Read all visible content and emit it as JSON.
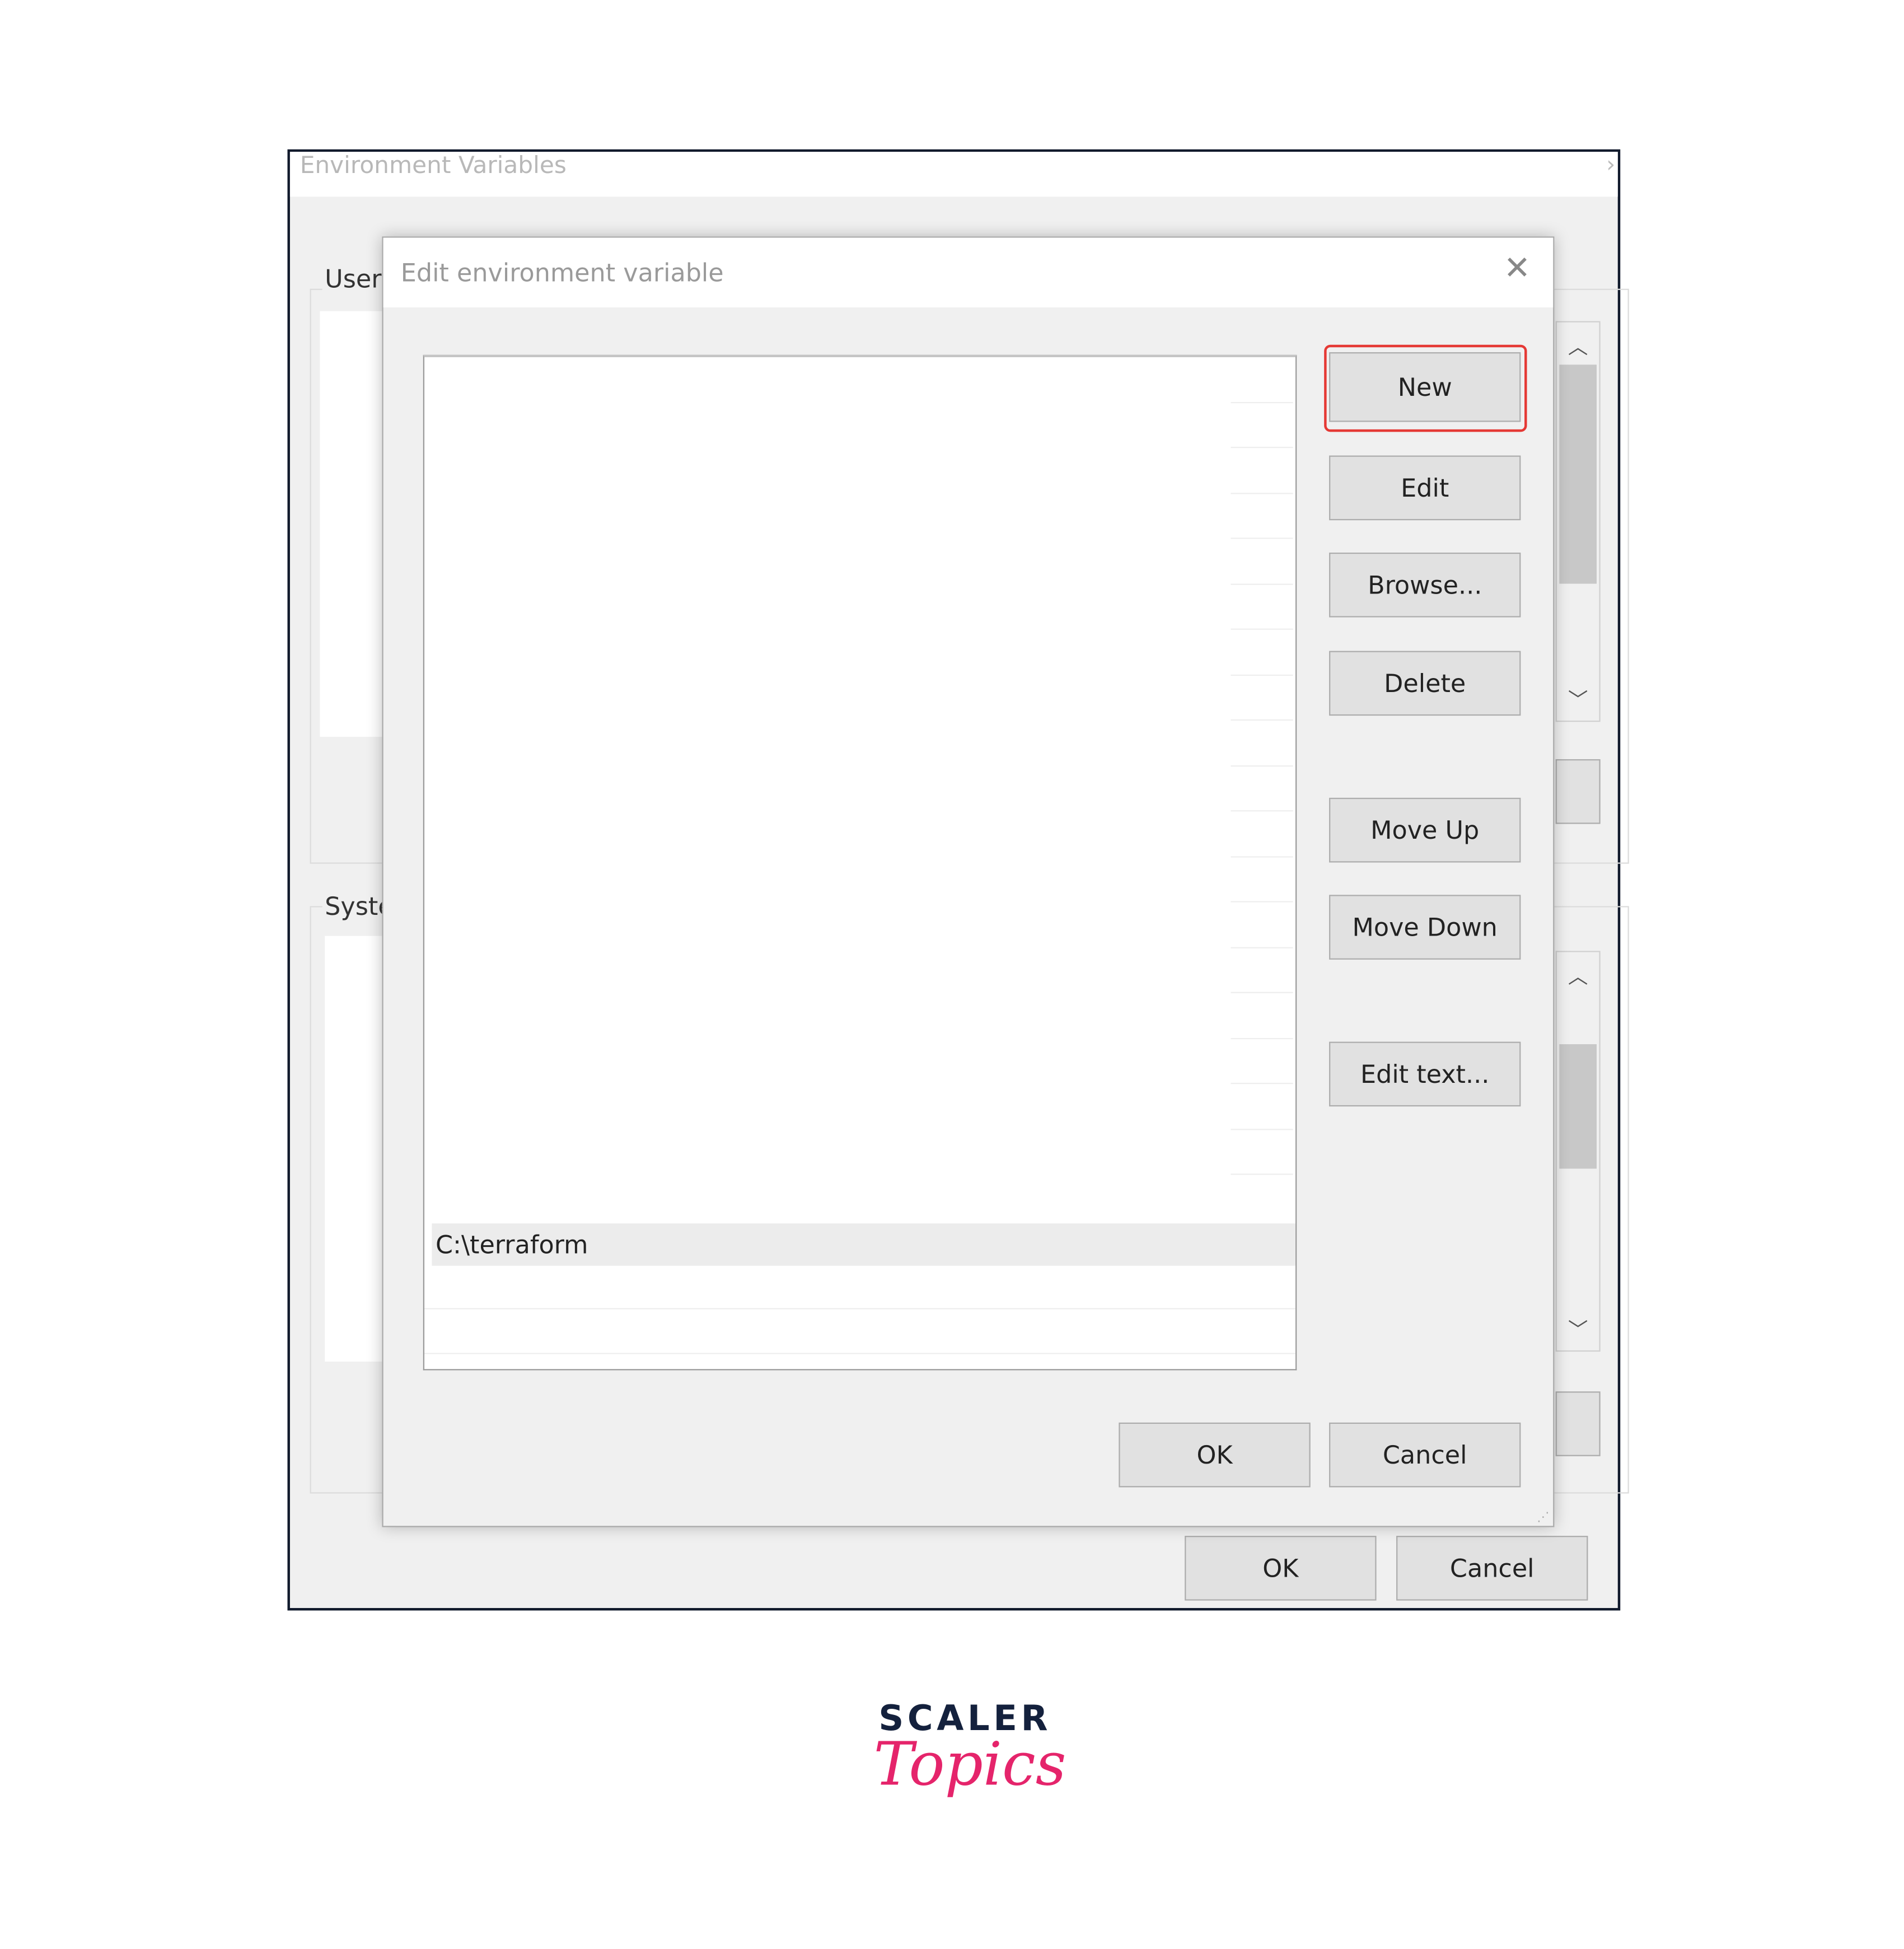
{
  "outer_window": {
    "title": "Environment Variables",
    "user_group_label": "User",
    "system_group_label": "Syste",
    "ok_label": "OK",
    "cancel_label": "Cancel"
  },
  "dialog": {
    "title": "Edit environment variable",
    "list_items": [
      "C:\\terraform"
    ],
    "selected_item": "C:\\terraform",
    "buttons": {
      "new": "New",
      "edit": "Edit",
      "browse": "Browse...",
      "delete": "Delete",
      "move_up": "Move Up",
      "move_down": "Move Down",
      "edit_text": "Edit text..."
    },
    "ok_label": "OK",
    "cancel_label": "Cancel",
    "highlight_color": "#e53935"
  },
  "logo": {
    "line1": "SCALER",
    "line2": "Topics",
    "color1": "#14213d",
    "color2": "#e5246b"
  }
}
